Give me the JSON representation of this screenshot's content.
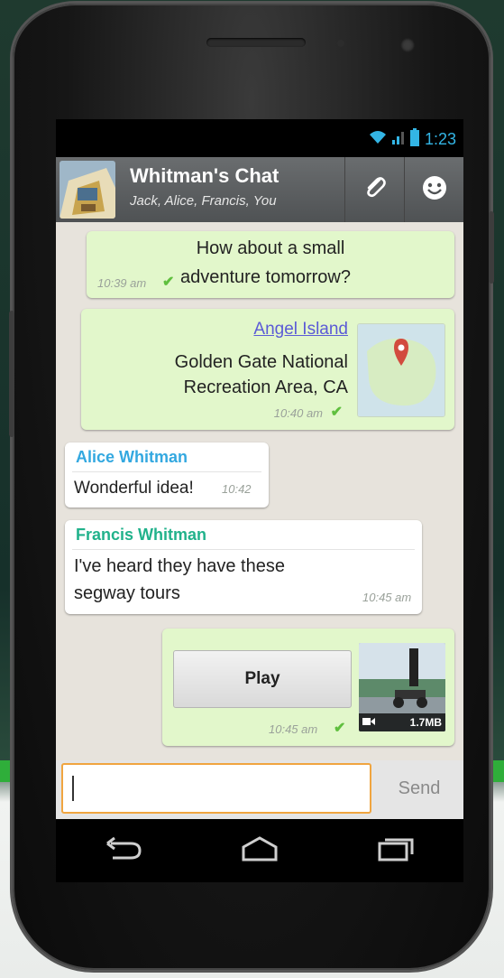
{
  "status_bar": {
    "time": "1:23"
  },
  "chat": {
    "title": "Whitman's Chat",
    "participants": "Jack, Alice, Francis, You"
  },
  "messages": [
    {
      "type": "outgoing-text",
      "text_line1": "How about a small",
      "text_line2": "adventure tomorrow?",
      "time": "10:39 am"
    },
    {
      "type": "outgoing-location",
      "place_link": "Angel Island",
      "address_line1": "Golden Gate National",
      "address_line2": "Recreation Area, CA",
      "time": "10:40 am"
    },
    {
      "type": "incoming-text",
      "sender": "Alice Whitman",
      "text": "Wonderful idea!",
      "time": "10:42"
    },
    {
      "type": "incoming-text",
      "sender": "Francis Whitman",
      "text_line1": "I've heard they have these",
      "text_line2": "segway tours",
      "time": "10:45 am"
    },
    {
      "type": "outgoing-video",
      "button_label": "Play",
      "file_size": "1.7MB",
      "time": "10:45 am"
    }
  ],
  "composer": {
    "placeholder": "",
    "send_label": "Send"
  },
  "colors": {
    "outgoing_bubble": "#e2f7cb",
    "incoming_bubble": "#ffffff",
    "alice_name": "#33a8e0",
    "francis_name": "#21b28b",
    "link": "#5b5bd6",
    "accent_holo": "#33b5e5",
    "input_focus": "#f0a540"
  },
  "icons": {
    "attach": "paperclip-icon",
    "emoji": "smiley-icon",
    "wifi": "wifi-icon",
    "signal": "signal-icon",
    "battery": "battery-icon",
    "back": "back-icon",
    "home": "home-icon",
    "recent": "recent-apps-icon",
    "check": "check-icon",
    "map_pin": "map-pin-icon",
    "video": "video-camera-icon"
  }
}
